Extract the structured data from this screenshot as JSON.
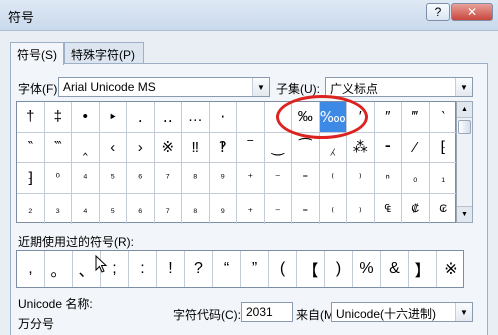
{
  "window": {
    "title": "符号",
    "help": "?",
    "close": "✕"
  },
  "tabs": [
    {
      "label": "符号(S)"
    },
    {
      "label": "特殊字符(P)"
    }
  ],
  "font": {
    "label": "字体(F):",
    "value": "Arial Unicode MS"
  },
  "subset": {
    "label": "子集(U):",
    "value": "广义标点"
  },
  "grid": {
    "rows": [
      [
        "†",
        "‡",
        "•",
        "‣",
        "․",
        "‥",
        "…",
        "‧",
        "",
        "",
        "‰",
        "‱",
        "′",
        "″",
        "‴",
        "‵"
      ],
      [
        "‶",
        "‷",
        "‸",
        "‹",
        "›",
        "※",
        "‼",
        "‽",
        "‾",
        "‿",
        "⁀",
        "⁁",
        "⁂",
        "⁃",
        "⁄",
        "⁅"
      ],
      [
        "⁆",
        "⁰",
        "⁴",
        "⁵",
        "⁶",
        "⁷",
        "⁸",
        "⁹",
        "⁺",
        "⁻",
        "⁼",
        "⁽",
        "⁾",
        "ⁿ",
        "₀",
        "₁"
      ],
      [
        "₂",
        "₃",
        "₄",
        "₅",
        "₆",
        "₇",
        "₈",
        "₉",
        "₊",
        "₋",
        "₌",
        "₍",
        "₎",
        "₠",
        "₡",
        "₢"
      ]
    ],
    "selected": "‱"
  },
  "recent": {
    "label": "近期使用过的符号(R):",
    "items": [
      ",",
      "。",
      "、",
      ";",
      ":",
      "!",
      "?",
      "“",
      "”",
      "(",
      "【",
      ")",
      "%",
      "&",
      "】",
      "※"
    ]
  },
  "unicode_name": {
    "label": "Unicode 名称:",
    "value": "万分号"
  },
  "char_code": {
    "label": "字符代码(C):",
    "value": "2031"
  },
  "from": {
    "label": "来自(M):",
    "value": "Unicode(十六进制)"
  }
}
